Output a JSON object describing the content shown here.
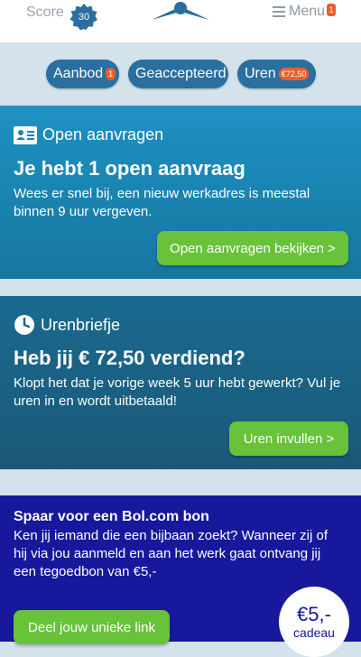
{
  "header": {
    "score_label": "Score",
    "score_value": "30",
    "menu_label": "Menu",
    "menu_badge": "1"
  },
  "tabs": [
    {
      "label": "Aanbod",
      "badge": "1"
    },
    {
      "label": "Geaccepteerd",
      "badge": ""
    },
    {
      "label": "Uren",
      "badge": "€72,50"
    }
  ],
  "cards": {
    "open": {
      "heading": "Open aanvragen",
      "title": "Je hebt 1 open aanvraag",
      "text": "Wees er snel bij, een nieuw werkadres is meestal binnen 9 uur vergeven.",
      "button": "Open aanvragen bekijken >"
    },
    "urenbriefje": {
      "heading": "Urenbriefje",
      "title": "Heb jij € 72,50 verdiend?",
      "text": "Klopt het dat je vorige week 5 uur hebt gewerkt? Vul je uren in en wordt uitbetaald!",
      "button": "Uren invullen >"
    },
    "bol": {
      "title": "Spaar voor een Bol.com bon",
      "text": "Ken jij iemand die een bijbaan zoekt? Wanneer zij of hij via jou aanmeld en aan het werk gaat ontvang jij een tegoedbon van €5,-",
      "button": "Deel jouw unieke link",
      "cadeau_amount": "€5,-",
      "cadeau_label": "cadeau"
    }
  },
  "colors": {
    "accent": "#2a6fa0",
    "badge": "#e95f2b",
    "button": "#68c23a",
    "promo": "#17189b"
  },
  "icons": {
    "score": "badge-star-icon",
    "logo": "app-logo",
    "menu": "hamburger-icon",
    "open_aanvragen": "id-card-icon",
    "urenbriefje": "clock-icon"
  }
}
